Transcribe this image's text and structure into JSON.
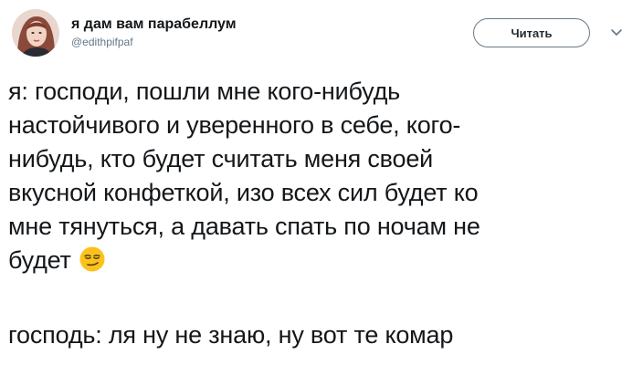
{
  "user": {
    "display_name": "я дам вам парабеллум",
    "handle": "@edithpifpaf",
    "avatar_icon": "avatar"
  },
  "follow_button": {
    "label": "Читать"
  },
  "more_menu_icon": "chevron-down-icon",
  "tweet": {
    "lines": [
      "я: господи, пошли мне кого-нибудь",
      "настойчивого и уверенного в себе, кого-",
      "нибудь, кто будет считать меня своей",
      "вкусной конфеткой, изо всех сил будет ко",
      "мне тянуться, а давать спать по ночам не",
      "будет"
    ],
    "emoji_icon": "smirking-face-emoji",
    "reply": "господь: ля ну не знаю, ну вот те комар"
  },
  "colors": {
    "text": "#14171a",
    "handle": "#657786",
    "button_border": "#6b7984",
    "emoji": "#fcc21b"
  }
}
